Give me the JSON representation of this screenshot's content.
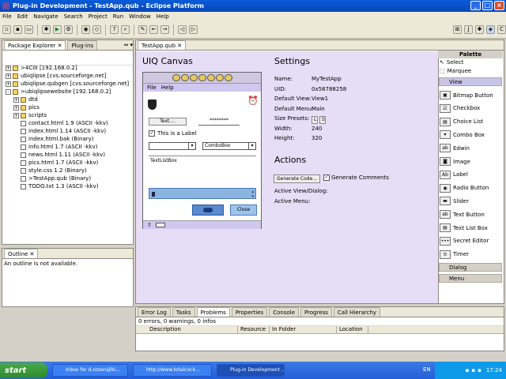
{
  "window": {
    "title": "Plug-in Development - TestApp.qub - Eclipse Platform"
  },
  "menu": [
    "File",
    "Edit",
    "Navigate",
    "Search",
    "Project",
    "Run",
    "Window",
    "Help"
  ],
  "explorer": {
    "tabs": [
      "Package Explorer",
      "Plug-ins"
    ],
    "items": [
      {
        "label": ">4C0I  [192.168.0.2]",
        "indent": 0,
        "exp": "+",
        "kind": "project"
      },
      {
        "label": "ubiqlipse  [cvs.sourceforge.net]",
        "indent": 0,
        "exp": "+",
        "kind": "project"
      },
      {
        "label": "ubiqlipse.qubgen  [cvs.sourceforge.net]",
        "indent": 0,
        "exp": "+",
        "kind": "project"
      },
      {
        "label": ">ubiqlipsewebsite  [192.168.0.2]",
        "indent": 0,
        "exp": "-",
        "kind": "project"
      },
      {
        "label": "dtd",
        "indent": 1,
        "exp": "+",
        "kind": "folder"
      },
      {
        "label": "pics",
        "indent": 1,
        "exp": "+",
        "kind": "folder"
      },
      {
        "label": "scripts",
        "indent": 1,
        "exp": "+",
        "kind": "folder"
      },
      {
        "label": "contact.html  1.9  (ASCII -kkv)",
        "indent": 1,
        "kind": "file"
      },
      {
        "label": "index.html  1.14  (ASCII -kkv)",
        "indent": 1,
        "kind": "file"
      },
      {
        "label": "index.html.bak   (Binary)",
        "indent": 1,
        "kind": "file"
      },
      {
        "label": "info.html  1.7  (ASCII -kkv)",
        "indent": 1,
        "kind": "file"
      },
      {
        "label": "news.html  1.11  (ASCII -kkv)",
        "indent": 1,
        "kind": "file"
      },
      {
        "label": "pics.html  1.7  (ASCII -kkv)",
        "indent": 1,
        "kind": "file"
      },
      {
        "label": "style.css  1.2  (Binary)",
        "indent": 1,
        "kind": "file"
      },
      {
        "label": ">TestApp.qub   (Binary)",
        "indent": 1,
        "kind": "file"
      },
      {
        "label": "TODO.txt  1.3  (ASCII -kkv)",
        "indent": 1,
        "kind": "file"
      }
    ]
  },
  "outline": {
    "tab": "Outline",
    "message": "An outline is not available."
  },
  "editor": {
    "tab": "TestApp.qub",
    "canvas_title": "UIQ Canvas",
    "device": {
      "menu": [
        "File",
        "Help"
      ],
      "text_btn": "Text....",
      "password": "********",
      "checkbox_label": "This is a Label",
      "combo": "ComboBox",
      "listbox": "TextListBox",
      "close": "Close"
    },
    "settings": {
      "title": "Settings",
      "rows": [
        {
          "k": "Name:",
          "v": "MyTestApp"
        },
        {
          "k": "UID:",
          "v": "0x58788258"
        },
        {
          "k": "Default View:",
          "v": "View1"
        },
        {
          "k": "Default Menu:",
          "v": "Main"
        },
        {
          "k": "Size Presets:",
          "v": ""
        },
        {
          "k": "Width:",
          "v": "240"
        },
        {
          "k": "Height:",
          "v": "320"
        }
      ],
      "preset_l": "L",
      "preset_s": "S"
    },
    "actions": {
      "title": "Actions",
      "gen_code": "Generate Code...",
      "gen_comments": "Generate Comments",
      "active_view": "Active View/Dialog:",
      "active_menu": "Active Menu:"
    }
  },
  "palette": {
    "title": "Palette",
    "tools": [
      "Select",
      "Marquee"
    ],
    "cat_view": "View",
    "items": [
      "Bitmap Button",
      "Checkbox",
      "Choice List",
      "Combo Box",
      "Edwin",
      "Image",
      "Label",
      "Radio Button",
      "Slider",
      "Text Button",
      "Text List Box",
      "Secret Editor",
      "Timer"
    ],
    "cat_dialog": "Dialog",
    "cat_menu": "Menu"
  },
  "bottom": {
    "tabs": [
      "Error Log",
      "Tasks",
      "Problems",
      "Properties",
      "Console",
      "Progress",
      "Call Hierarchy"
    ],
    "status": "0 errors, 0 warnings, 0 infos",
    "columns": [
      "Description",
      "Resource",
      "In Folder",
      "Location"
    ]
  },
  "taskbar": {
    "start": "start",
    "buttons": [
      "Inbox for d.ozsen@bi...",
      "http://www.totalcock...",
      "Plug-in Development ..."
    ],
    "lang": "EN",
    "time": "17:24"
  }
}
